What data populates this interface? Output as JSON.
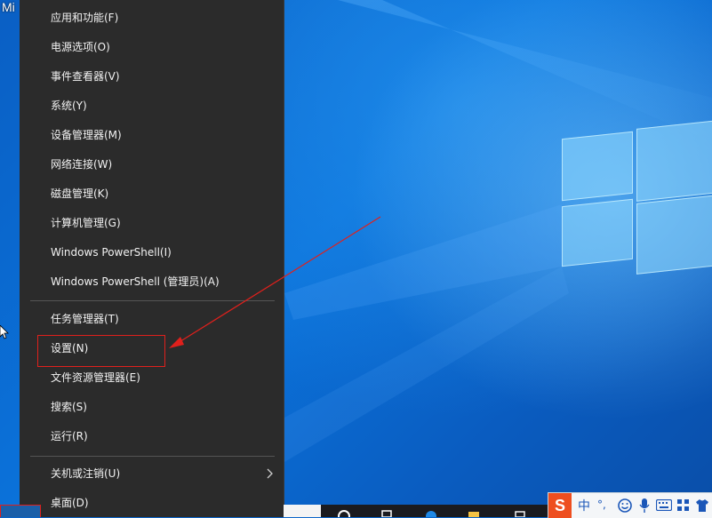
{
  "desktop": {
    "corner_label": "Mi"
  },
  "menu": {
    "group1": [
      {
        "label": "应用和功能(F)"
      },
      {
        "label": "电源选项(O)"
      },
      {
        "label": "事件查看器(V)"
      },
      {
        "label": "系统(Y)"
      },
      {
        "label": "设备管理器(M)"
      },
      {
        "label": "网络连接(W)"
      },
      {
        "label": "磁盘管理(K)"
      },
      {
        "label": "计算机管理(G)"
      },
      {
        "label": "Windows PowerShell(I)"
      },
      {
        "label": "Windows PowerShell (管理员)(A)"
      }
    ],
    "group2": [
      {
        "label": "任务管理器(T)"
      },
      {
        "label": "设置(N)"
      },
      {
        "label": "文件资源管理器(E)"
      },
      {
        "label": "搜索(S)"
      },
      {
        "label": "运行(R)"
      }
    ],
    "group3": [
      {
        "label": "关机或注销(U)"
      },
      {
        "label": "桌面(D)"
      }
    ]
  },
  "ime": {
    "logo": "S",
    "mode": "中",
    "punct": "°,",
    "emoji_icon": "smiley-icon",
    "mic_icon": "microphone-icon",
    "keyboard_icon": "keyboard-icon",
    "tools_icon": "grid-icon",
    "skin_icon": "shirt-icon"
  },
  "colors": {
    "menu_bg": "#2b2b2b",
    "annotation": "#e0201c",
    "ime_accent": "#ee4e1f"
  }
}
